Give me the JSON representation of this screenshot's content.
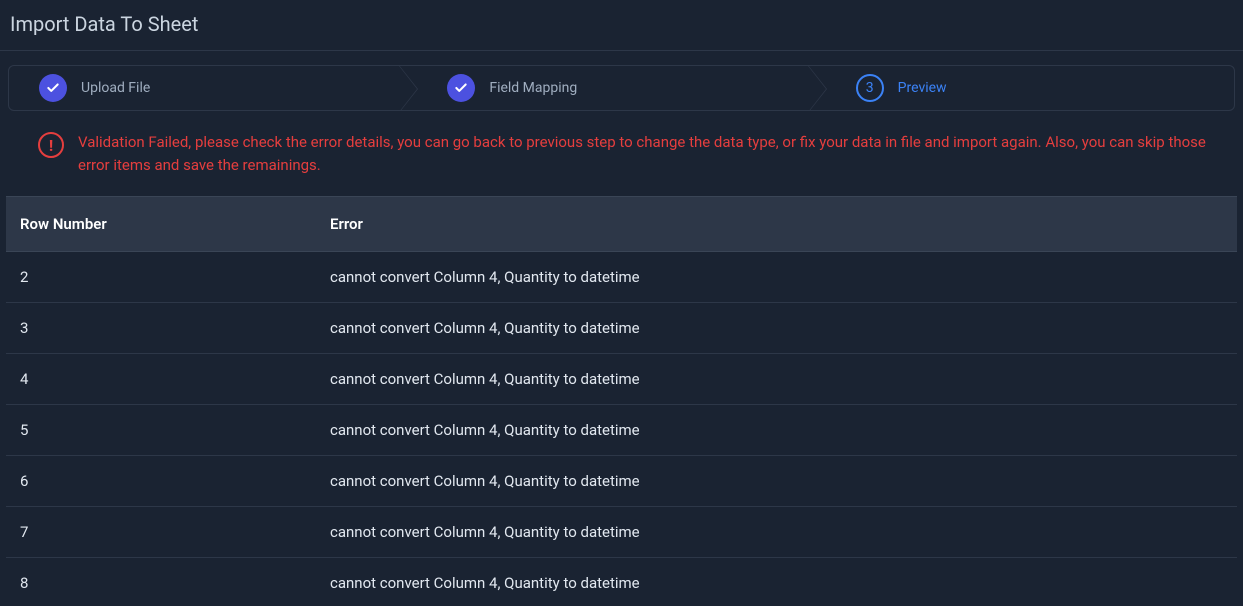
{
  "header": {
    "title": "Import Data To Sheet"
  },
  "stepper": {
    "steps": [
      {
        "label": "Upload File",
        "state": "complete"
      },
      {
        "label": "Field Mapping",
        "state": "complete"
      },
      {
        "label": "Preview",
        "state": "active",
        "number": "3"
      }
    ]
  },
  "alert": {
    "message": "Validation Failed, please check the error details, you can go back to previous step to change the data type, or fix your data in file and import again. Also, you can skip those error items and save the remainings."
  },
  "table": {
    "columns": {
      "row_number": "Row Number",
      "error": "Error"
    },
    "rows": [
      {
        "row": "2",
        "error": "cannot convert Column 4, Quantity to datetime"
      },
      {
        "row": "3",
        "error": "cannot convert Column 4, Quantity to datetime"
      },
      {
        "row": "4",
        "error": "cannot convert Column 4, Quantity to datetime"
      },
      {
        "row": "5",
        "error": "cannot convert Column 4, Quantity to datetime"
      },
      {
        "row": "6",
        "error": "cannot convert Column 4, Quantity to datetime"
      },
      {
        "row": "7",
        "error": "cannot convert Column 4, Quantity to datetime"
      },
      {
        "row": "8",
        "error": "cannot convert Column 4, Quantity to datetime"
      }
    ]
  }
}
